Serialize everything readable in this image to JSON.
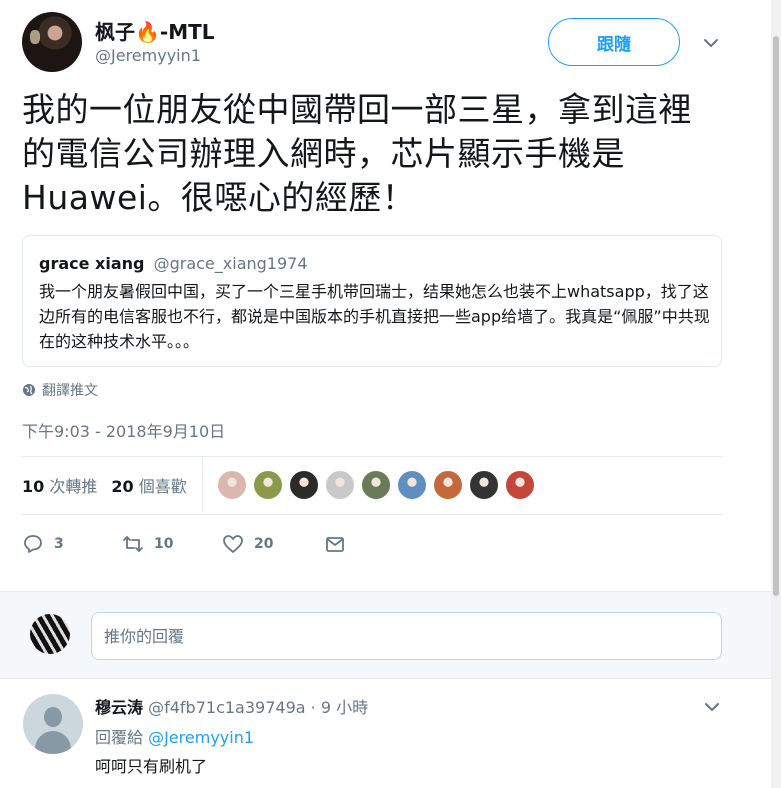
{
  "tweet": {
    "display_name": "枫子",
    "display_name_emoji": "🔥",
    "display_name_suffix": "-MTL",
    "handle": "@Jeremyyin1",
    "follow_label": "跟隨",
    "text": "我的一位朋友從中國帶回一部三星，拿到這裡的電信公司辦理入網時，芯片顯示手機是Huawei。很噁心的經歷！",
    "translate_label": "翻譯推文",
    "timestamp": "下午9:03 - 2018年9月10日",
    "retweet_count": "10",
    "retweet_label": "次轉推",
    "like_count": "20",
    "like_label": "個喜歡",
    "actions": {
      "reply_count": "3",
      "retweet_count": "10",
      "like_count": "20"
    }
  },
  "quote": {
    "name": "grace xiang",
    "handle": "@grace_xiang1974",
    "text": "我一个朋友暑假回中国，买了一个三星手机带回瑞士，结果她怎么也装不上whatsapp，找了这边所有的电信客服也不行，都说是中国版本的手机直接把一些app给墙了。我真是“佩服”中共现在的这种技术水平。。。"
  },
  "likers": [
    "#d9b8b0",
    "#8a9a4a",
    "#2b2b2b",
    "#c9c9c9",
    "#6b7b5a",
    "#5e8fbf",
    "#c46a3a",
    "#333333",
    "#c4473b"
  ],
  "reply_box": {
    "placeholder": "推你的回覆"
  },
  "reply": {
    "name": "穆云涛",
    "handle": "@f4fb71c1a39749a",
    "time": "· 9 小時",
    "reply_to_label": "回覆給",
    "reply_to_handle": "@Jeremyyin1",
    "text": "呵呵只有刷机了"
  },
  "colors": {
    "accent": "#1da1f2",
    "muted": "#657786",
    "text": "#14171a"
  }
}
